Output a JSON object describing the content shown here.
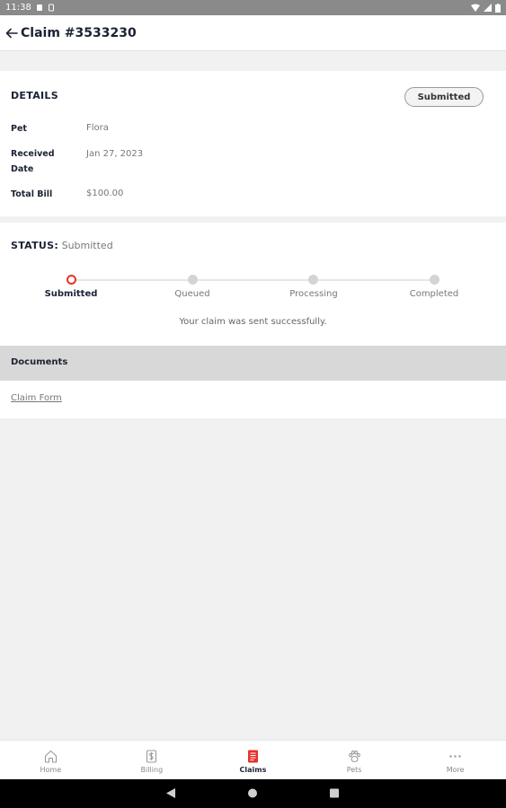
{
  "status_bar": {
    "time": "11:38"
  },
  "header": {
    "title": "Claim #3533230"
  },
  "details": {
    "title": "DETAILS",
    "badge": "Submitted",
    "rows": [
      {
        "label": "Pet",
        "value": "Flora"
      },
      {
        "label": "Received",
        "label2": "Date",
        "value": "Jan 27, 2023"
      },
      {
        "label": "Total Bill",
        "value": "$100.00"
      }
    ]
  },
  "status": {
    "title": "STATUS:",
    "value": "Submitted",
    "steps": [
      "Submitted",
      "Queued",
      "Processing",
      "Completed"
    ],
    "active_step": 0,
    "message": "Your claim was sent successfully."
  },
  "documents": {
    "title": "Documents",
    "links": [
      "Claim Form"
    ]
  },
  "bottom_nav": {
    "items": [
      {
        "label": "Home",
        "icon": "home-icon"
      },
      {
        "label": "Billing",
        "icon": "dollar-icon"
      },
      {
        "label": "Claims",
        "icon": "document-icon"
      },
      {
        "label": "Pets",
        "icon": "paw-icon"
      },
      {
        "label": "More",
        "icon": "more-dots-icon"
      }
    ],
    "active_index": 2,
    "accent": "#e8322b"
  },
  "colors": {
    "accent": "#e8322b",
    "text_dark": "#1b2233",
    "muted": "#777777"
  }
}
